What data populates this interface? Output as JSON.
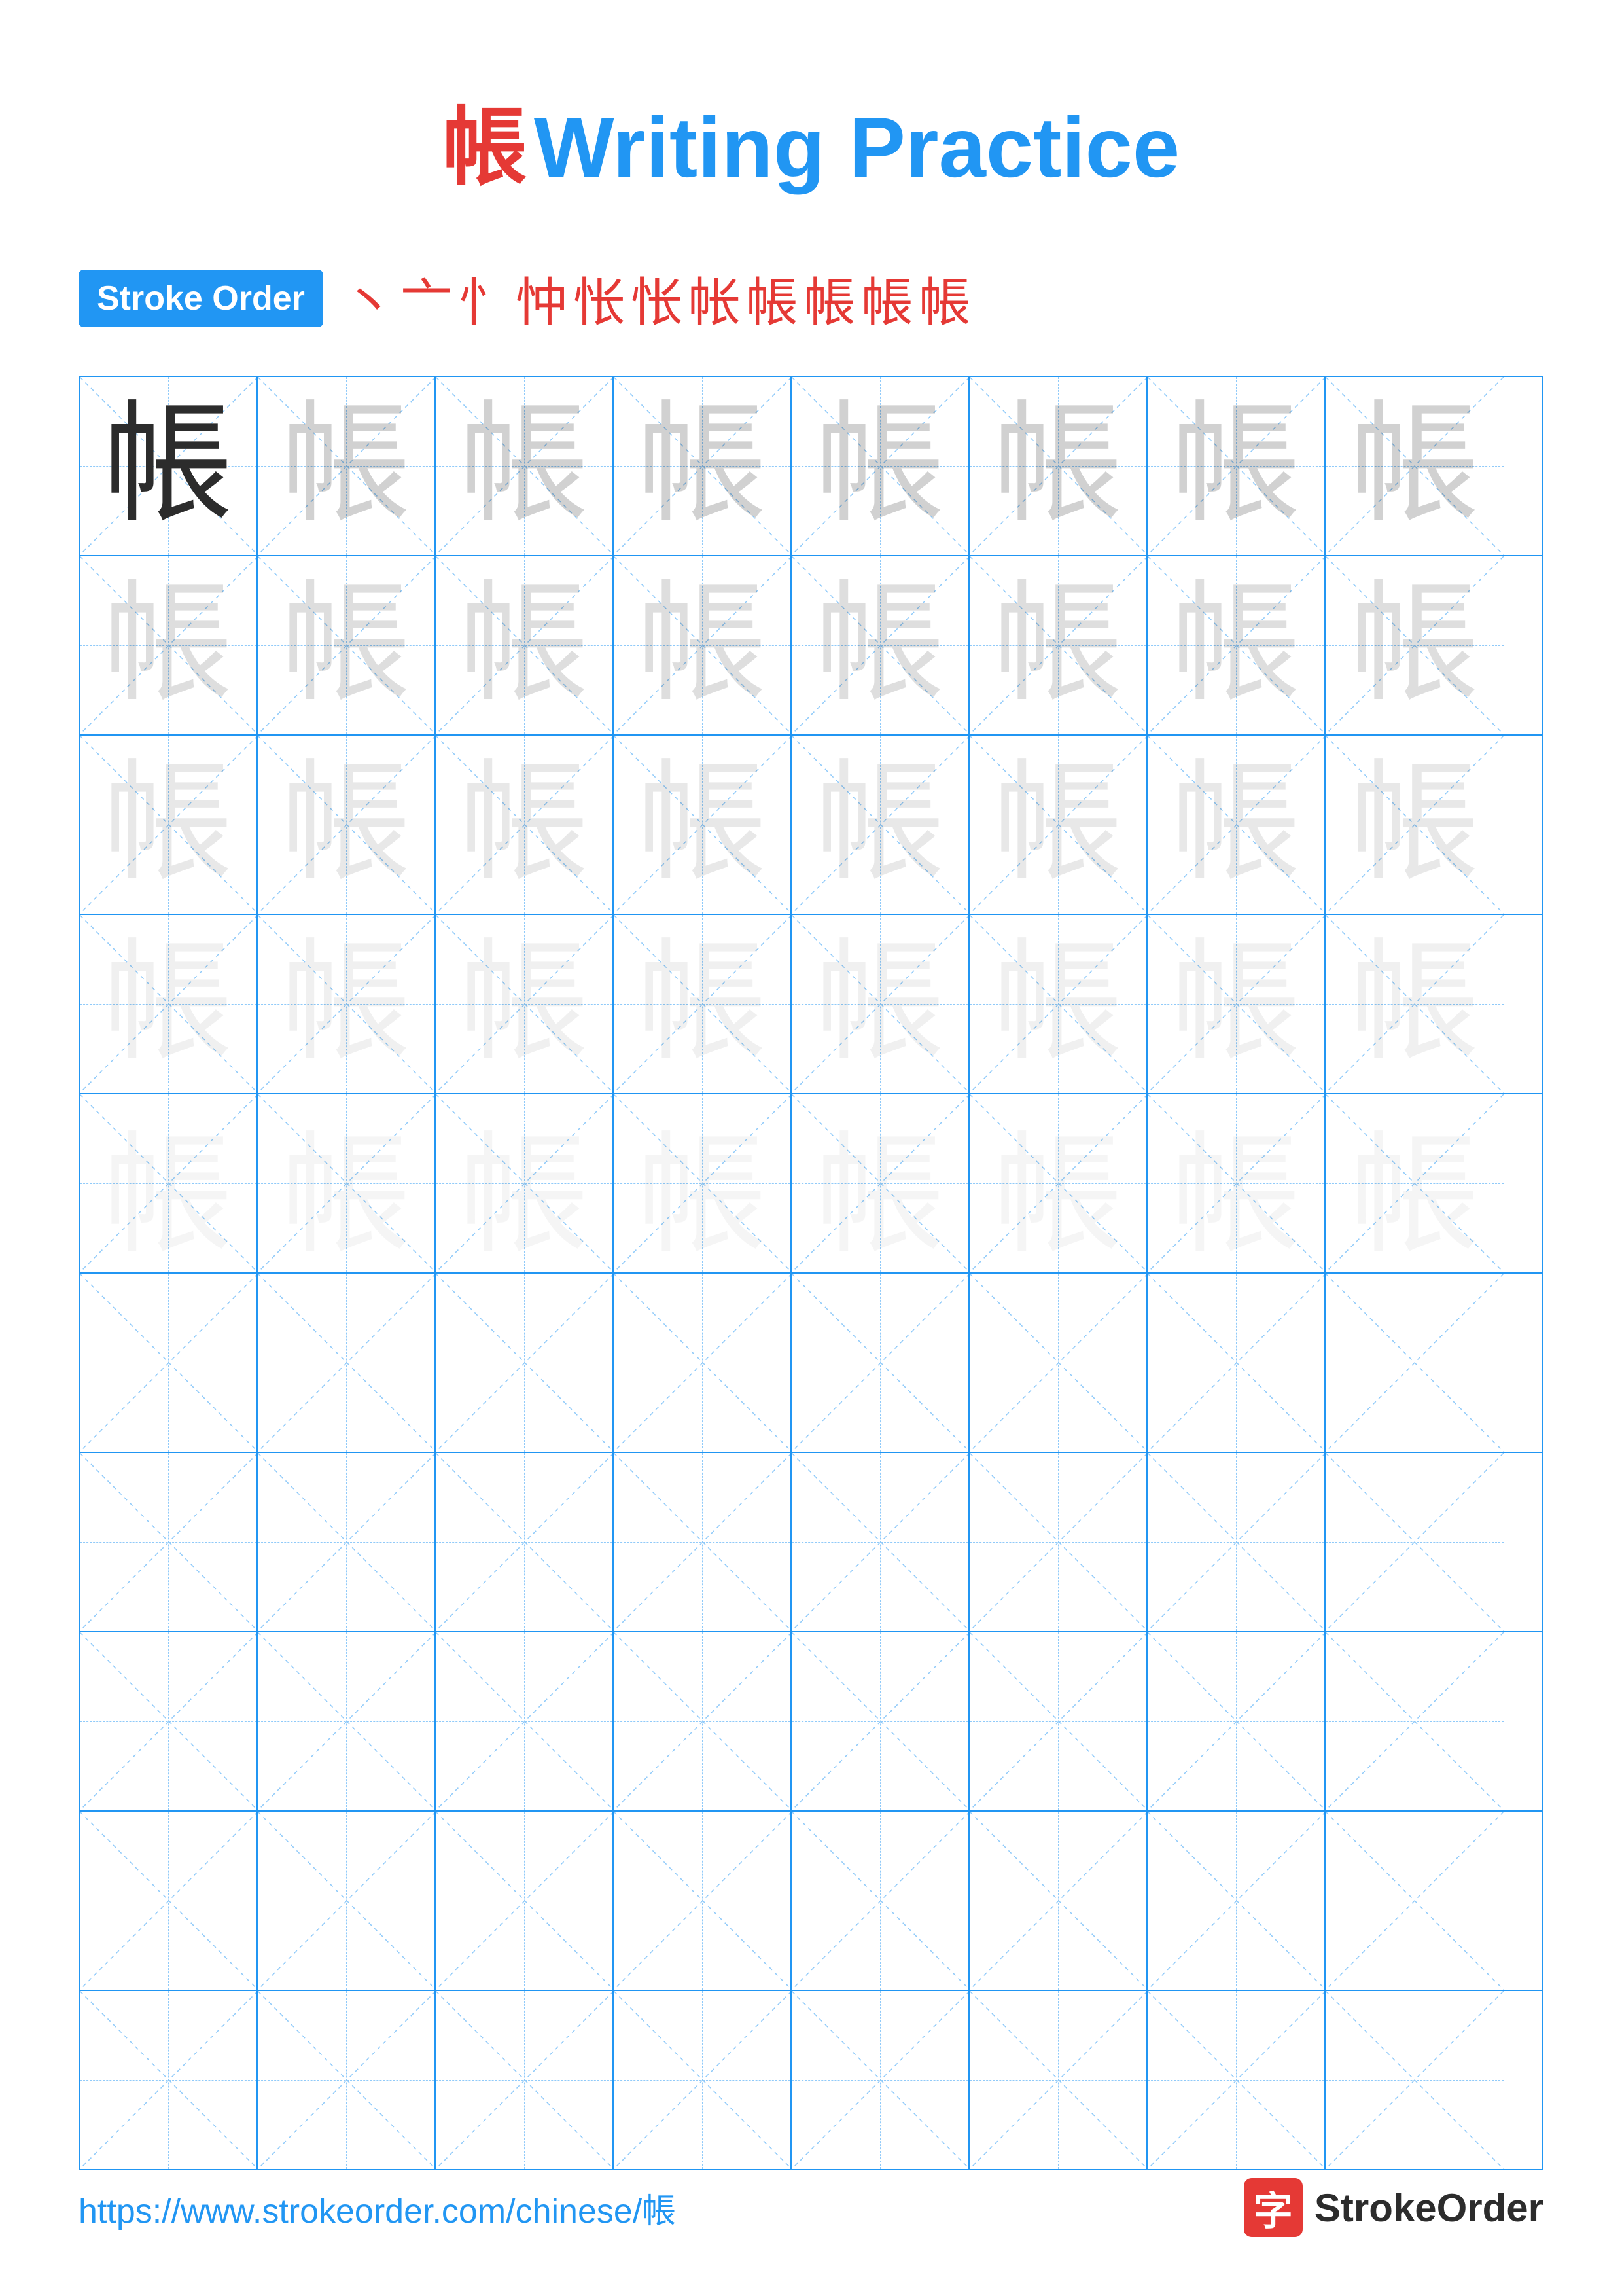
{
  "page": {
    "title": "Writing Practice",
    "title_char": "帳",
    "stroke_order_label": "Stroke Order",
    "stroke_steps": [
      "丶",
      "亠",
      "忄",
      "忡",
      "忡",
      "忡",
      "怅",
      "帐",
      "帳",
      "帳",
      "帳"
    ],
    "practice_char": "帳",
    "footer_url": "https://www.strokeorder.com/chinese/帳",
    "footer_logo_char": "字",
    "footer_brand": "StrokeOrder"
  }
}
